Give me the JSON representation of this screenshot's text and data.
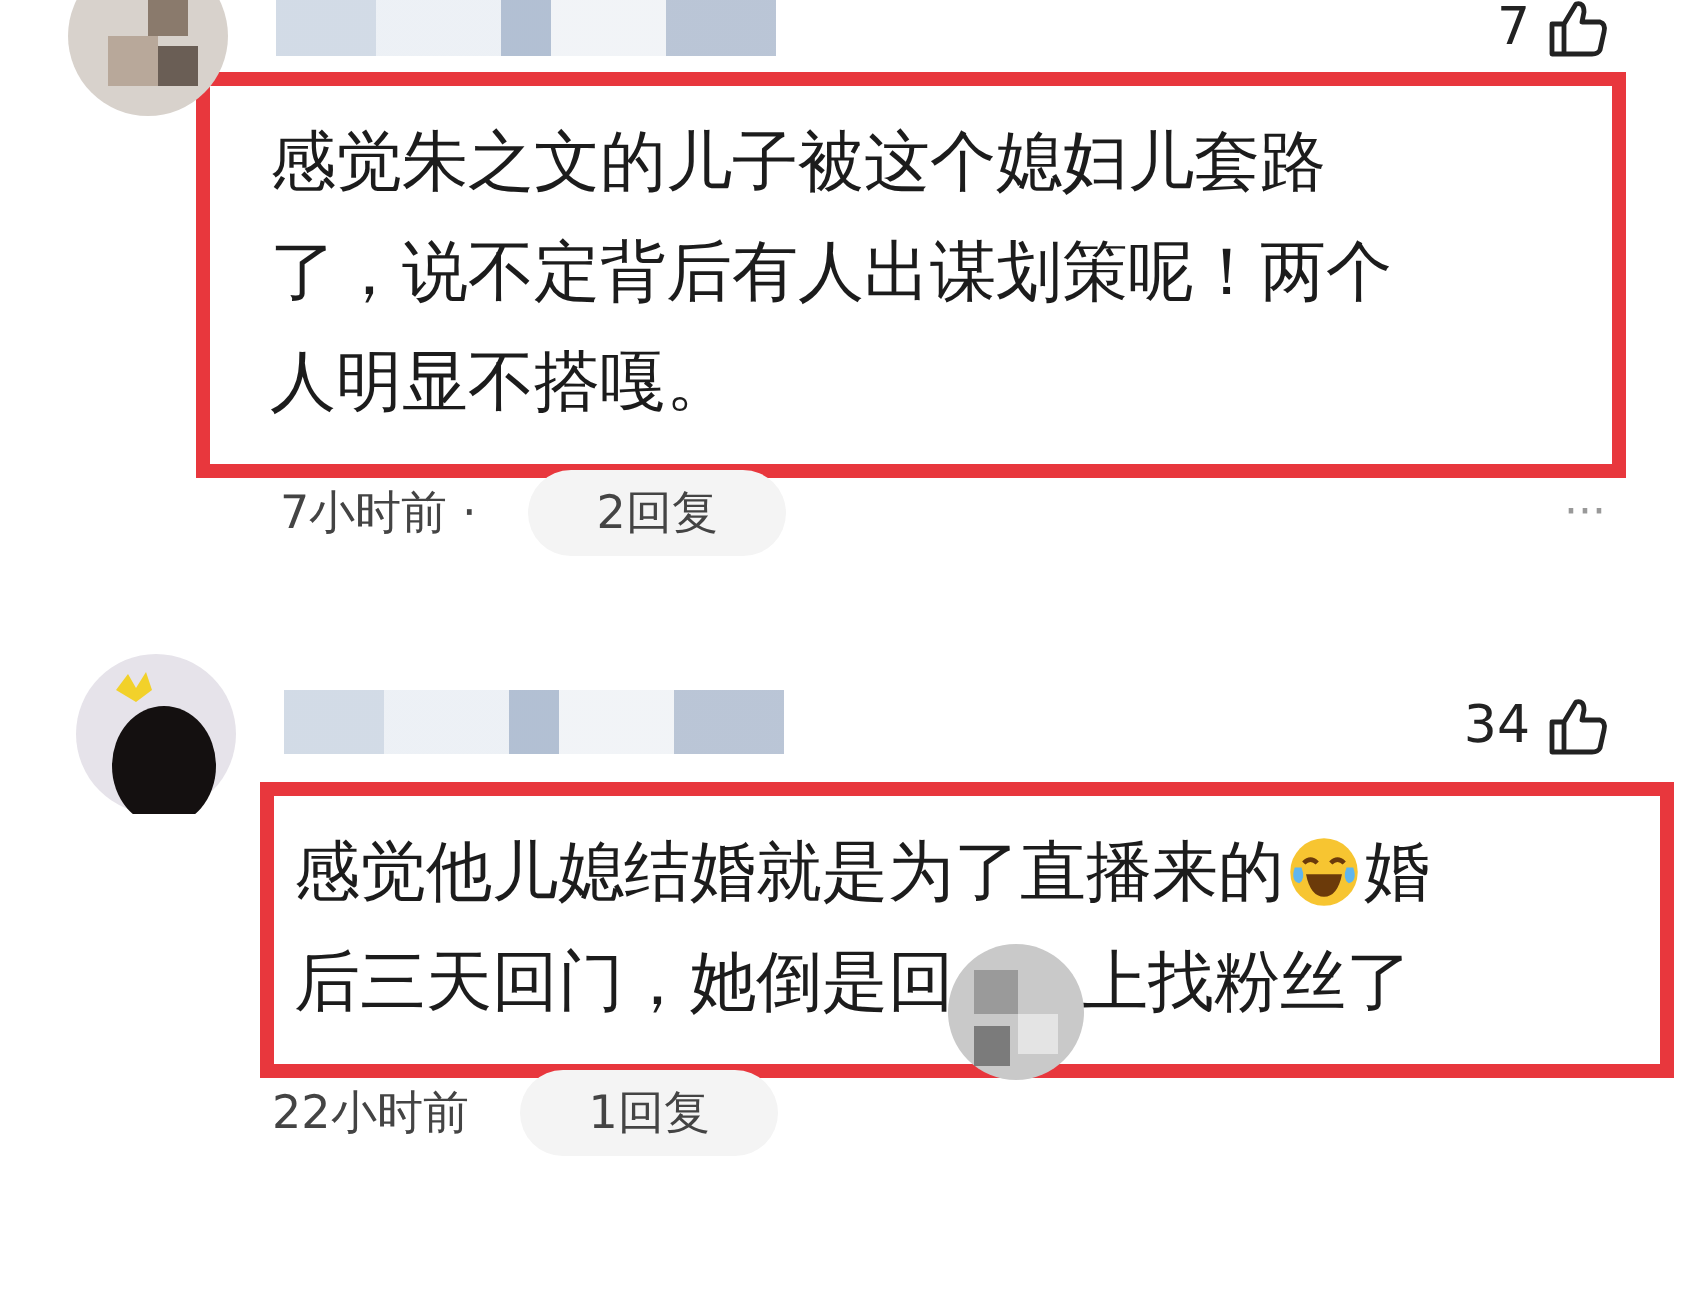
{
  "comments": [
    {
      "likes": "7",
      "lines": [
        [
          {
            "kind": "text",
            "text": "感觉朱之文的儿子被这个媳妇儿套路"
          }
        ],
        [
          {
            "kind": "text",
            "text": "了，说不定背后有人出谋划策呢！两个"
          }
        ],
        [
          {
            "kind": "text",
            "text": "人明显不搭嘎。"
          }
        ]
      ],
      "time": "7小时前 ·",
      "replies": "2回复",
      "more": "···"
    },
    {
      "likes": "34",
      "lines": [
        [
          {
            "kind": "text",
            "text": "感觉他儿媳结婚就是为了直播来的"
          },
          {
            "kind": "emoji"
          },
          {
            "kind": "text",
            "text": "婚"
          }
        ],
        [
          {
            "kind": "text",
            "text": "后三天回门，她倒是回"
          },
          {
            "kind": "hidden"
          },
          {
            "kind": "text",
            "text": "上找粉丝了"
          }
        ]
      ],
      "time": "22小时前",
      "replies": "1回复"
    }
  ]
}
